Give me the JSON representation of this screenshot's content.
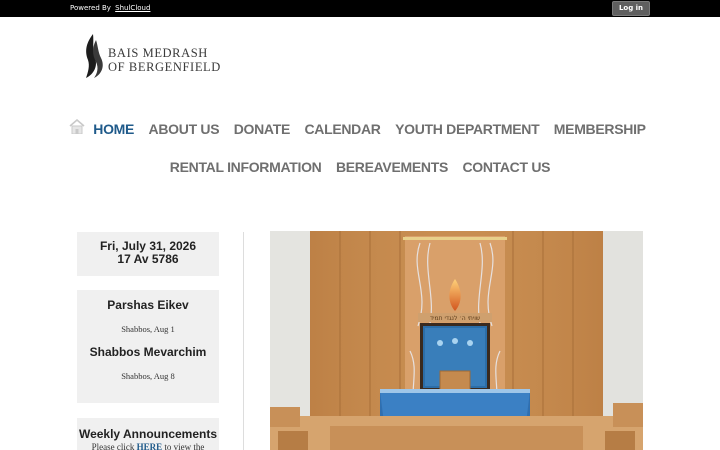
{
  "topbar": {
    "powered_by": "Powered By",
    "powered_link": "ShulCloud",
    "login_label": "Log in"
  },
  "logo": {
    "line1": "BAIS MEDRASH",
    "line2": "OF BERGENFIELD"
  },
  "nav": {
    "row1": [
      "HOME",
      "ABOUT US",
      "DONATE",
      "CALENDAR",
      "YOUTH DEPARTMENT",
      "MEMBERSHIP"
    ],
    "row2": [
      "RENTAL INFORMATION",
      "BEREAVEMENTS",
      "CONTACT US"
    ],
    "active": "HOME"
  },
  "sidebar": {
    "date": {
      "gregorian": "Fri, July 31, 2026",
      "hebrew": "17 Av 5786"
    },
    "parsha": {
      "title": "Parshas Eikev",
      "date": "Shabbos, Aug 1",
      "title2": "Shabbos Mevarchim",
      "date2": "Shabbos, Aug 8"
    },
    "announcements": {
      "title": "Weekly Announcements",
      "text_before": "Please click",
      "link": "HERE",
      "text_after": "to view the"
    }
  },
  "photo": {
    "ark_inscription": "שויתי ה׳ לנגדי תמיד"
  },
  "colors": {
    "nav_active": "#1f5a8a",
    "nav_default": "#6f6f6f",
    "topbar": "#000000"
  }
}
